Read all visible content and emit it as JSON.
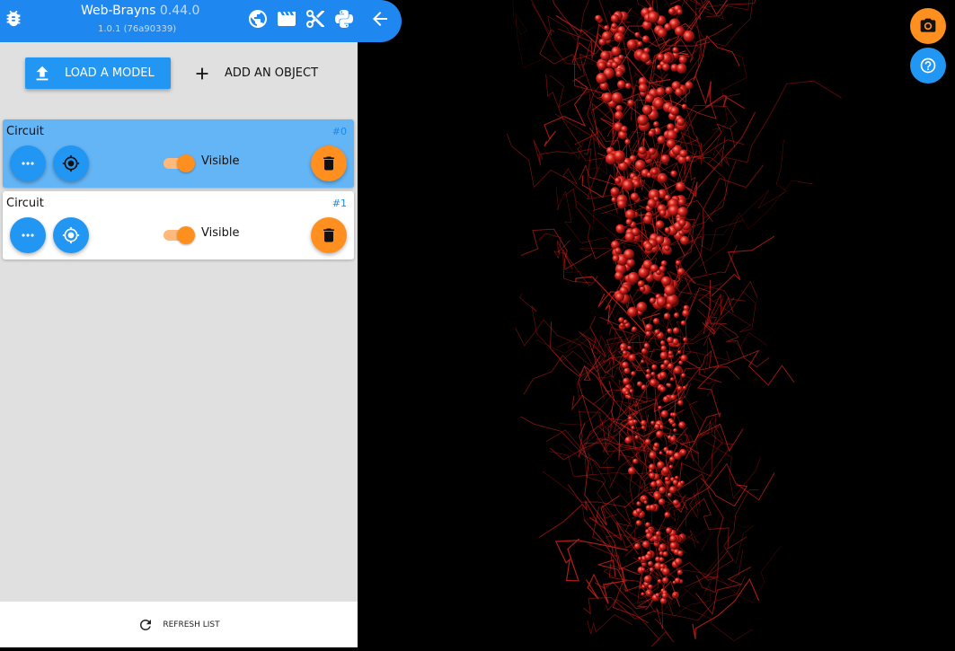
{
  "header": {
    "app_name": "Web-Brayns",
    "app_version": "0.44.0",
    "build": "1.0.1 (76a90339)",
    "icons": [
      "bug-icon",
      "globe-icon",
      "clapperboard-icon",
      "scissors-icon",
      "python-icon",
      "arrow-back-icon"
    ]
  },
  "panel": {
    "load_label": "LOAD A MODEL",
    "add_label": "ADD AN OBJECT",
    "models": [
      {
        "name": "Circuit",
        "index": "#0",
        "visible_label": "Visible",
        "selected": true
      },
      {
        "name": "Circuit",
        "index": "#1",
        "visible_label": "Visible",
        "selected": false
      }
    ],
    "refresh_label": "REFRESH LIST"
  },
  "colors": {
    "accent_blue": "#2196f3",
    "accent_orange": "#ff8f1f",
    "neuron_red": "#d8231d"
  }
}
